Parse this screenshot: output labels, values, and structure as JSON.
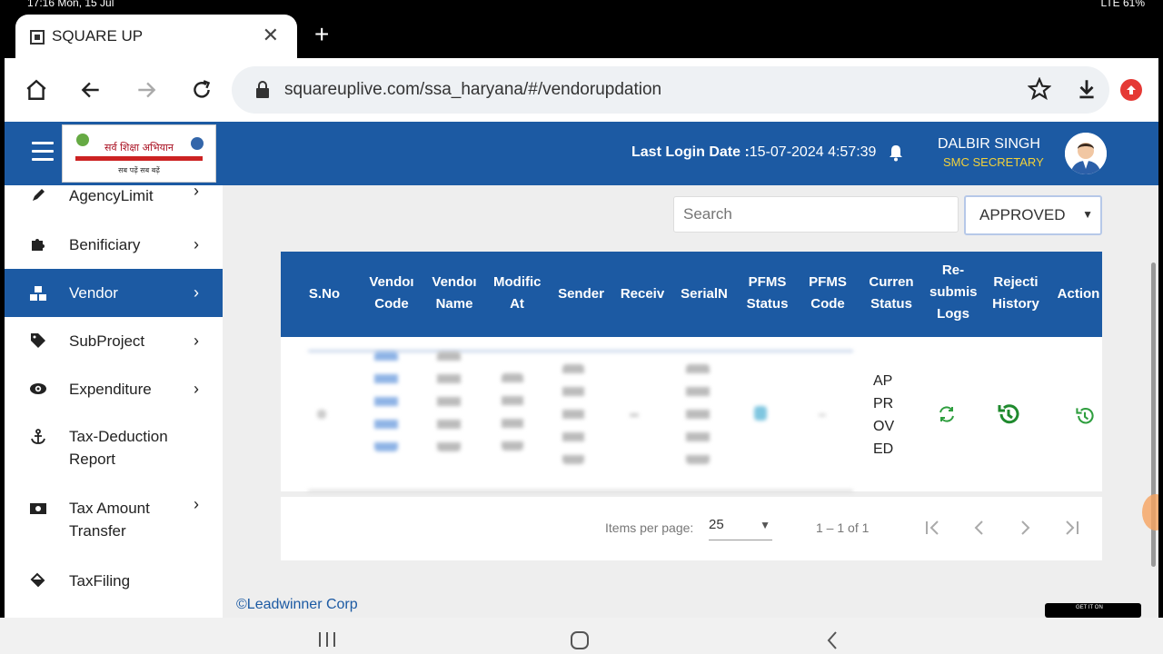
{
  "status_bar": {
    "time": "17:16 Mon, 15 Jul",
    "right": "LTE 61%"
  },
  "browser": {
    "tab_title": "SQUARE UP",
    "url": "squareuplive.com/ssa_haryana/#/vendorupdation"
  },
  "header": {
    "logo_text": "सर्व शिक्षा अभियान",
    "logo_sub": "सब पढ़ें सब बढ़ें",
    "last_login_label": "Last Login Date :",
    "last_login_value": "15-07-2024 4:57:39",
    "user_name": "DALBIR SINGH",
    "user_role": "SMC SECRETARY"
  },
  "sidebar": {
    "items": [
      {
        "label": "AgencyLimit",
        "icon": "pen-icon",
        "has_chevron": true,
        "active": false
      },
      {
        "label": "Benificiary",
        "icon": "puzzle-icon",
        "has_chevron": true,
        "active": false
      },
      {
        "label": "Vendor",
        "icon": "cubes-icon",
        "has_chevron": true,
        "active": true
      },
      {
        "label": "SubProject",
        "icon": "tag-icon",
        "has_chevron": true,
        "active": false
      },
      {
        "label": "Expenditure",
        "icon": "eye-icon",
        "has_chevron": true,
        "active": false
      },
      {
        "label": "Tax-Deduction",
        "label2": "Report",
        "icon": "anchor-icon",
        "has_chevron": false,
        "active": false
      },
      {
        "label": "Tax Amount",
        "label2": "Transfer",
        "icon": "money-icon",
        "has_chevron": true,
        "active": false
      },
      {
        "label": "TaxFiling",
        "icon": "fill-drip-icon",
        "has_chevron": false,
        "active": false
      }
    ]
  },
  "filters": {
    "search_placeholder": "Search",
    "status_value": "APPROVED"
  },
  "table": {
    "columns": [
      {
        "l1": "S.No",
        "l2": ""
      },
      {
        "l1": "Vendoı",
        "l2": "Code"
      },
      {
        "l1": "Vendoı",
        "l2": "Name"
      },
      {
        "l1": "Modific",
        "l2": "At"
      },
      {
        "l1": "Sender",
        "l2": ""
      },
      {
        "l1": "Receiv",
        "l2": ""
      },
      {
        "l1": "SerialN",
        "l2": ""
      },
      {
        "l1": "PFMS",
        "l2": "Status"
      },
      {
        "l1": "PFMS",
        "l2": "Code"
      },
      {
        "l1": "Curren",
        "l2": "Status"
      },
      {
        "l1": "Re-",
        "l2": "submis",
        "l3": "Logs"
      },
      {
        "l1": "Rejecti",
        "l2": "History"
      },
      {
        "l1": "Action",
        "l2": ""
      }
    ],
    "rows": [
      {
        "current_status": [
          "AP",
          "PR",
          "OV",
          "ED"
        ]
      }
    ]
  },
  "paginator": {
    "items_per_page_label": "Items per page:",
    "page_size": "25",
    "range_label": "1 – 1 of 1"
  },
  "footer": {
    "copyright": "©Leadwinner Corp",
    "gplay": "GET IT ON"
  },
  "colors": {
    "primary": "#1c5aa3",
    "role": "#f2d13a",
    "green": "#2e9e3e"
  }
}
